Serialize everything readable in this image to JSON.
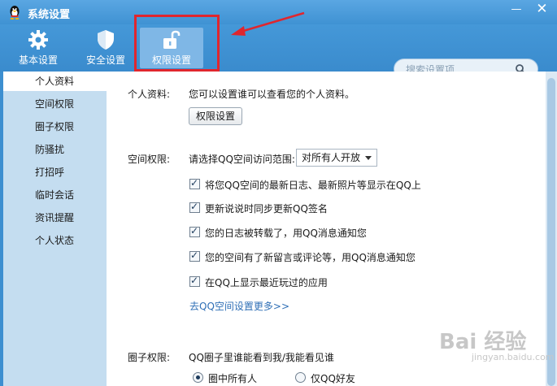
{
  "window": {
    "title": "系统设置",
    "minimize": "—",
    "close": "✕"
  },
  "toolbar": {
    "items": [
      {
        "label": "基本设置",
        "icon": "gear-icon"
      },
      {
        "label": "安全设置",
        "icon": "shield-icon"
      },
      {
        "label": "权限设置",
        "icon": "unlock-icon",
        "selected": true
      }
    ]
  },
  "search": {
    "placeholder": "搜索设置项"
  },
  "sidebar": {
    "items": [
      {
        "label": "个人资料",
        "active": true
      },
      {
        "label": "空间权限"
      },
      {
        "label": "圈子权限"
      },
      {
        "label": "防骚扰"
      },
      {
        "label": "打招呼"
      },
      {
        "label": "临时会话"
      },
      {
        "label": "资讯提醒"
      },
      {
        "label": "个人状态"
      }
    ]
  },
  "personal": {
    "label": "个人资料:",
    "desc": "您可以设置谁可以查看您的个人资料。",
    "button": "权限设置"
  },
  "space": {
    "label": "空间权限:",
    "range_label": "请选择QQ空间访问范围:",
    "range_value": "对所有人开放",
    "options": [
      {
        "text": "将您QQ空间的最新日志、最新照片等显示在QQ上",
        "checked": true
      },
      {
        "text": "更新说说时同步更新QQ签名",
        "checked": true
      },
      {
        "text": "您的日志被转载了，用QQ消息通知您",
        "checked": true
      },
      {
        "text": "您的空间有了新留言或评论等，用QQ消息通知您",
        "checked": true
      },
      {
        "text": "在QQ上显示最近玩过的应用",
        "checked": true
      }
    ],
    "more_link": "去QQ空间设置更多>>"
  },
  "circle": {
    "label": "圈子权限:",
    "desc": "QQ圈子里谁能看到我/我能看见谁",
    "radio_a": "圈中所有人",
    "radio_b": "仅QQ好友"
  },
  "watermark": {
    "main": "Bai 经验",
    "sub": "jingyan.baidu.com"
  },
  "colors": {
    "accent": "#3d8fd0",
    "highlight": "#e0262e",
    "link": "#2f6fb6"
  }
}
